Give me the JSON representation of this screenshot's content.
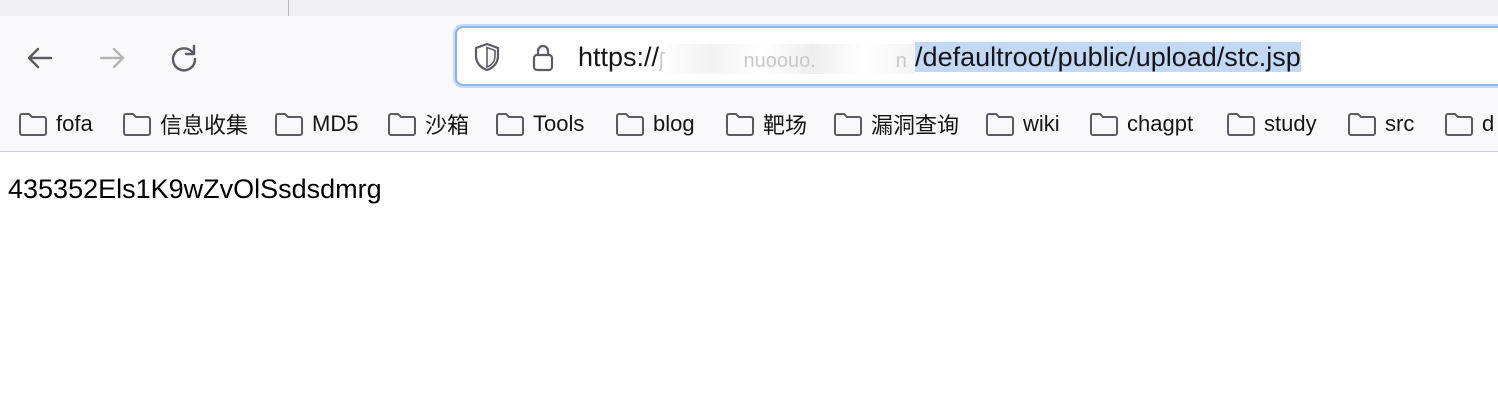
{
  "toolbar": {
    "back_icon": "arrow-left-icon",
    "forward_icon": "arrow-right-icon",
    "reload_icon": "reload-icon"
  },
  "urlbar": {
    "scheme": "https://",
    "redacted_host_fragments": "ʃ　　　　nuoouo.　　　　n",
    "path_selected": "/defaultroot/public/upload/stc.jsp",
    "icons": [
      "shield-icon",
      "lock-icon"
    ]
  },
  "bookmarks": [
    {
      "label": "fofa"
    },
    {
      "label": "信息收集"
    },
    {
      "label": "MD5"
    },
    {
      "label": "沙箱"
    },
    {
      "label": "Tools"
    },
    {
      "label": "blog"
    },
    {
      "label": "靶场"
    },
    {
      "label": "漏洞查询"
    },
    {
      "label": "wiki"
    },
    {
      "label": "chagpt"
    },
    {
      "label": "study"
    },
    {
      "label": "src"
    },
    {
      "label": "d"
    }
  ],
  "page": {
    "body_text": "435352Els1K9wZvOlSsdsdmrg"
  },
  "colors": {
    "toolbar_bg": "#f9f9fb",
    "tabstrip_bg": "#f0f0f4",
    "url_focus": "#8fb3e8",
    "selection": "#c3d8f4",
    "icon": "#5b5b66",
    "icon_disabled": "#b3b3b8"
  }
}
